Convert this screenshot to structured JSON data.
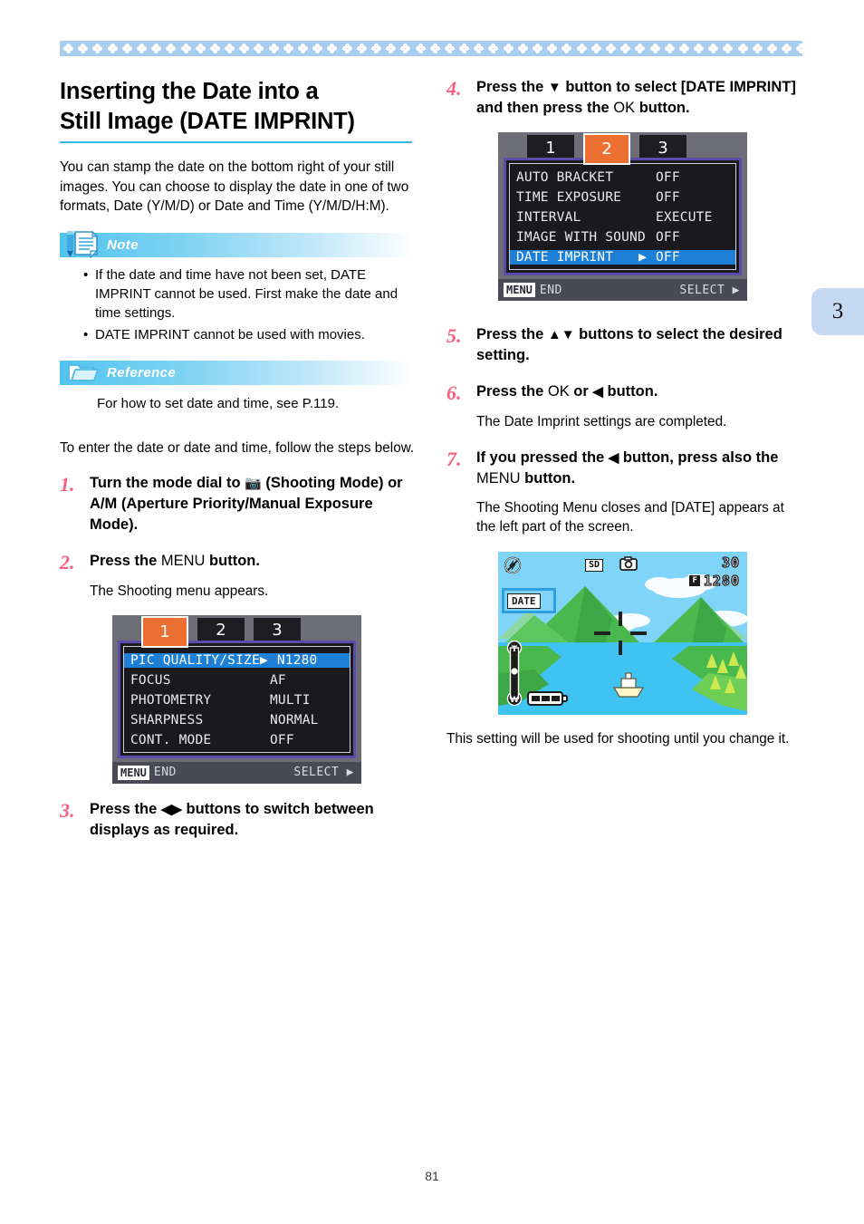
{
  "page": {
    "number": "81",
    "tab_marker": "3"
  },
  "heading": {
    "line1": "Inserting the Date into a",
    "line2": "Still Image (DATE IMPRINT)"
  },
  "intro": "You can stamp the date on the bottom right of your still images. You can choose to display the date in one of two formats, Date (Y/M/D) or Date and Time (Y/M/D/H:M).",
  "note": {
    "label": "Note",
    "icon": "note-document-icon",
    "bullets": [
      "If the date and time have not been set, DATE IMPRINT cannot be used. First make the date and time settings.",
      "DATE IMPRINT cannot be used with movies."
    ]
  },
  "reference": {
    "label": "Reference",
    "icon": "folder-icon",
    "text": "For how to set date and time, see P.119."
  },
  "lead_text": "To enter the date or date and time, follow the steps below.",
  "steps": [
    {
      "num": "1.",
      "text_pre": "Turn the mode dial to ",
      "icon": "camera-icon",
      "text_post": " (Shooting Mode) or A/M (Aperture Priority/Manual Exposure Mode)."
    },
    {
      "num": "2.",
      "text_pre": "Press the ",
      "key": "MENU",
      "text_post": " button.",
      "result": "The Shooting menu appears."
    },
    {
      "num": "3.",
      "text_pre": "Press the ",
      "icon": "left-right-arrows-icon",
      "text_post": " buttons to switch between displays as required."
    },
    {
      "num": "4.",
      "text_pre": "Press the ",
      "icon": "down-arrow-icon",
      "text_mid": " button to select [DATE IMPRINT] and then press the ",
      "key": "OK",
      "text_post": " button."
    },
    {
      "num": "5.",
      "text_pre": "Press the ",
      "icon": "up-down-arrows-icon",
      "text_post": " buttons to select the desired setting."
    },
    {
      "num": "6.",
      "text_pre": "Press the ",
      "key": "OK",
      "text_mid": " or ",
      "icon": "left-arrow-icon",
      "text_post": " button.",
      "result": "The Date Imprint settings are completed."
    },
    {
      "num": "7.",
      "text_pre": "If you pressed the ",
      "icon": "left-arrow-icon",
      "text_mid": " button, press also the ",
      "key": "MENU",
      "text_post": " button.",
      "result": "The Shooting Menu closes and [DATE] appears at the left part of the screen."
    }
  ],
  "closing_text": "This setting will be used for shooting until you change it.",
  "lcd_menu_1": {
    "tabs": [
      "1",
      "2",
      "3"
    ],
    "active_tab": "1",
    "rows": [
      {
        "label": "PIC QUALITY/SIZE",
        "value": "N1280",
        "selected": true,
        "arrow": "▶"
      },
      {
        "label": "FOCUS",
        "value": "AF",
        "selected": false
      },
      {
        "label": "PHOTOMETRY",
        "value": "MULTI",
        "selected": false
      },
      {
        "label": "SHARPNESS",
        "value": "NORMAL",
        "selected": false
      },
      {
        "label": "CONT. MODE",
        "value": "OFF",
        "selected": false
      }
    ],
    "footer": {
      "key": "MENU",
      "left": "END",
      "right": "SELECT",
      "right_arrow": "▶"
    }
  },
  "lcd_menu_2": {
    "tabs": [
      "1",
      "2",
      "3"
    ],
    "active_tab": "2",
    "rows": [
      {
        "label": "AUTO BRACKET",
        "value": "OFF",
        "selected": false
      },
      {
        "label": "TIME EXPOSURE",
        "value": "OFF",
        "selected": false
      },
      {
        "label": "INTERVAL",
        "value": "EXECUTE",
        "selected": false
      },
      {
        "label": "IMAGE WITH SOUND",
        "value": "OFF",
        "selected": false
      },
      {
        "label": "DATE IMPRINT",
        "value": "OFF",
        "selected": true,
        "arrow": "▶"
      }
    ],
    "footer": {
      "key": "MENU",
      "left": "END",
      "right": "SELECT",
      "right_arrow": "▶"
    }
  },
  "scene_screen": {
    "flash_icon": "flash-off-icon",
    "card_label": "SD",
    "mode_icon": "camera-icon",
    "shots_remaining": "30",
    "quality_badge": "F",
    "image_size": "1280",
    "date_badge": "DATE",
    "zoom_top": "T",
    "zoom_bottom": "W",
    "battery_icon": "battery-full-icon"
  },
  "colors": {
    "accent_rule": "#35b5e8",
    "step_number": "#f4607f",
    "info_header": "#51c3ef",
    "tab_marker_bg": "#c5d9f3",
    "lcd_highlight": "#1d7fd6",
    "lcd_tab_active": "#ec7033",
    "top_band": "#a8cdee"
  }
}
